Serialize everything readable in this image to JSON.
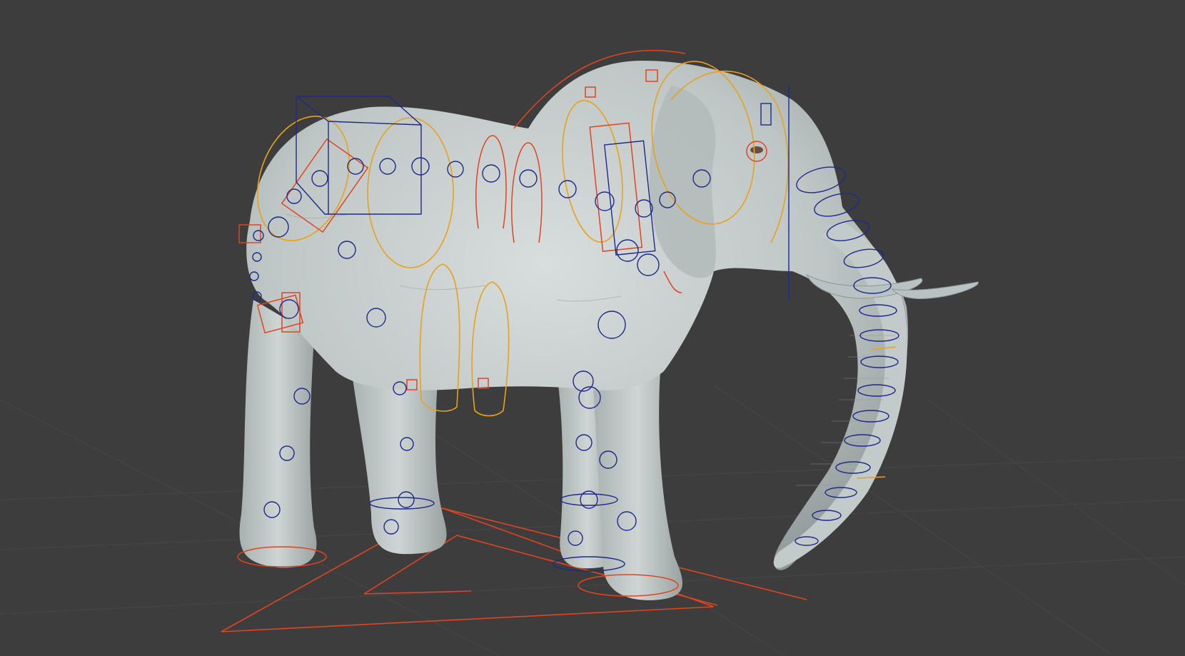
{
  "app": {
    "viewport_label": ""
  },
  "scene": {
    "subject": "elephant-sculpt-mesh",
    "colors": {
      "background": "#3d3d3d",
      "grid": "#4a4a4a",
      "mesh": "#c9cfcf",
      "mesh_shade": "#9aa3a3",
      "tusk": "#b9c2c2",
      "control_red": "#e0451f",
      "control_blue": "#1e2a8a",
      "control_yellow": "#e8a21a"
    },
    "icons": [
      "rig-control-circle",
      "rig-control-box",
      "rig-control-curve",
      "ik-handle"
    ]
  }
}
